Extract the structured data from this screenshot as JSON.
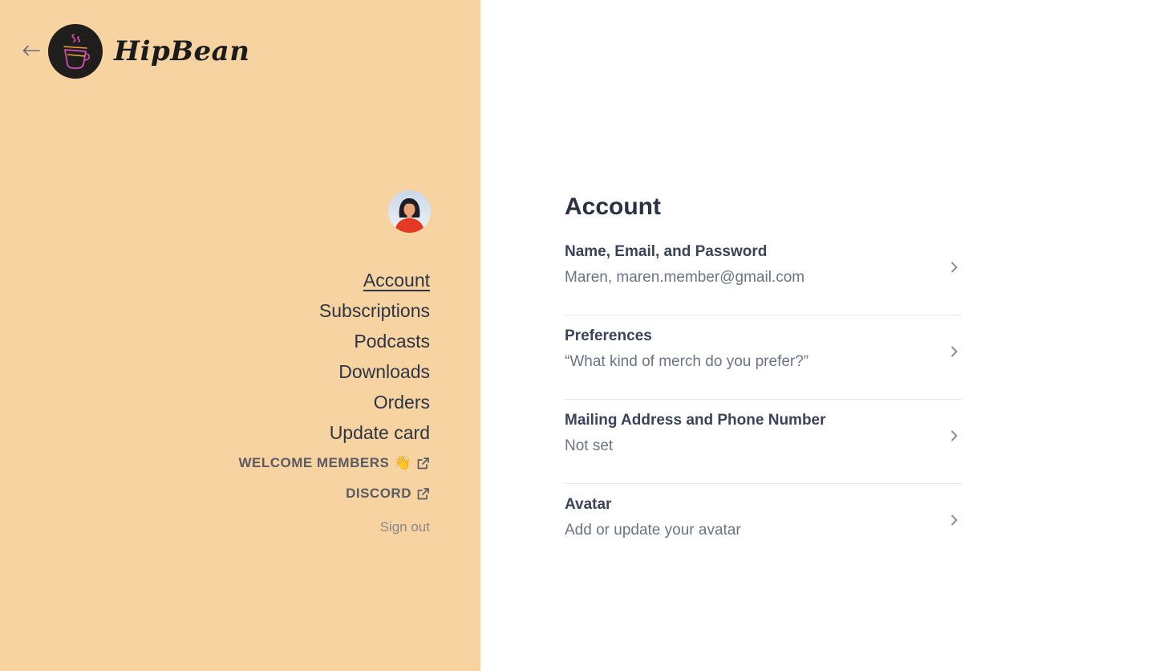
{
  "brand": {
    "name": "HipBean"
  },
  "sidebar": {
    "nav": [
      {
        "label": "Account",
        "active": true
      },
      {
        "label": "Subscriptions"
      },
      {
        "label": "Podcasts"
      },
      {
        "label": "Downloads"
      },
      {
        "label": "Orders"
      },
      {
        "label": "Update card"
      }
    ],
    "external_links": [
      {
        "label": "WELCOME MEMBERS",
        "emoji": "👋",
        "icon": "external-link-icon"
      },
      {
        "label": "DISCORD",
        "icon": "external-link-icon"
      }
    ],
    "signout_label": "Sign out"
  },
  "main": {
    "title": "Account",
    "rows": [
      {
        "title": "Name, Email, and Password",
        "subtitle": "Maren, maren.member@gmail.com"
      },
      {
        "title": "Preferences",
        "subtitle": "“What kind of merch do you prefer?”"
      },
      {
        "title": "Mailing Address and Phone Number",
        "subtitle": "Not set"
      },
      {
        "title": "Avatar",
        "subtitle": "Add or update your avatar"
      }
    ]
  },
  "colors": {
    "sidebar_bg": "#f7d3a1",
    "text_dark": "#2d3445",
    "logo_bg": "#1f1e1d",
    "logo_accent": "#d34fb3"
  }
}
